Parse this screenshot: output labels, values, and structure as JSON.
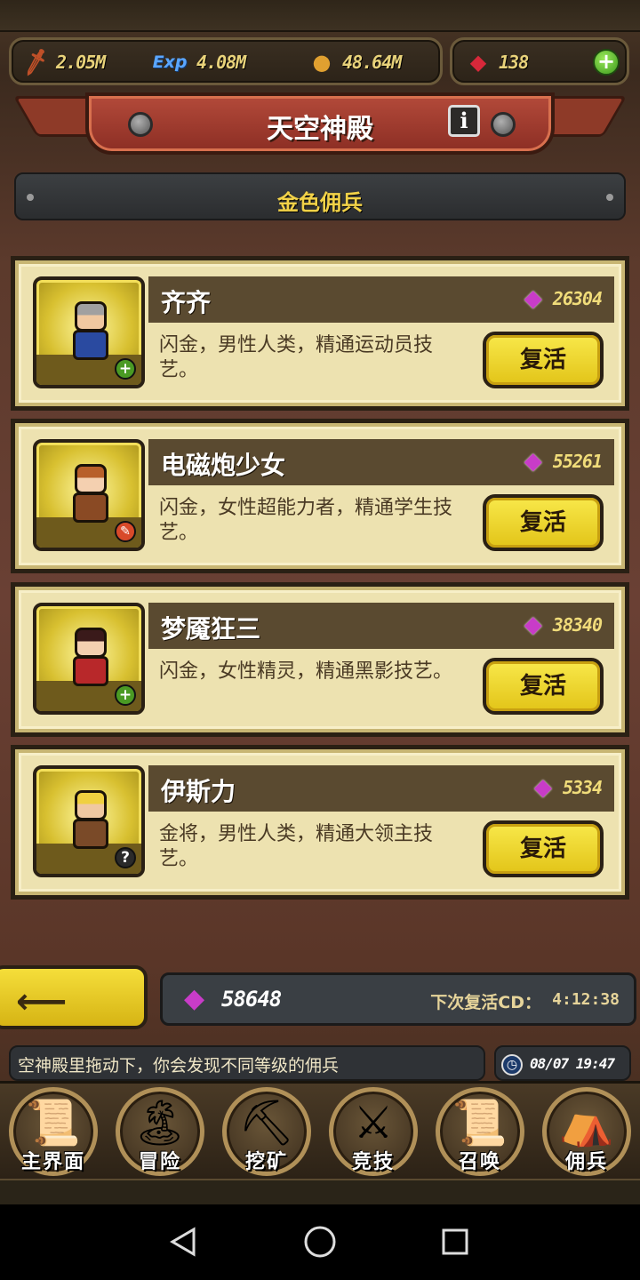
{
  "resources": {
    "attack": {
      "icon": "sword-icon",
      "value": "2.05M"
    },
    "exp": {
      "icon": "exp-icon",
      "label": "Exp",
      "value": "4.08M"
    },
    "gold": {
      "icon": "gold-coin-icon",
      "value": "48.64M"
    },
    "ruby": {
      "icon": "ruby-icon",
      "value": "138"
    }
  },
  "header": {
    "title": "天空神殿",
    "info_label": "i"
  },
  "category": {
    "label": "金色佣兵"
  },
  "heroes": [
    {
      "name": "齐齐",
      "cost": "26304",
      "desc": "闪金，男性人类，精通运动员技艺。",
      "button": "复活",
      "badge": "+",
      "palette": {
        "hair": "#a0a0a0",
        "body": "#2a4aa0",
        "skin": "#f0c8a0"
      }
    },
    {
      "name": "电磁炮少女",
      "cost": "55261",
      "desc": "闪金，女性超能力者，精通学生技艺。",
      "button": "复活",
      "badge": "✎",
      "palette": {
        "hair": "#b8602a",
        "body": "#8a4a24",
        "skin": "#f4d0b0"
      }
    },
    {
      "name": "梦魇狂三",
      "cost": "38340",
      "desc": "闪金，女性精灵，精通黑影技艺。",
      "button": "复活",
      "badge": "+",
      "palette": {
        "hair": "#3a1a1a",
        "body": "#b8282a",
        "skin": "#f4d0b0"
      }
    },
    {
      "name": "伊斯力",
      "cost": "5334",
      "desc": "金将，男性人类，精通大领主技艺。",
      "button": "复活",
      "badge": "?",
      "palette": {
        "hair": "#f0d040",
        "body": "#7a4a28",
        "skin": "#f0c8a0"
      }
    }
  ],
  "footer": {
    "back_label": "⟵",
    "gem_total": "58648",
    "cd_label": "下次复活CD：",
    "cd_value": "4:12:38",
    "ticker": "空神殿里拖动下，你会发现不同等级的佣兵",
    "datetime": "08/07 19:47"
  },
  "nav": [
    {
      "label": "主界面",
      "icon": "map-scroll-icon",
      "glyph": "📜"
    },
    {
      "label": "冒险",
      "icon": "island-icon",
      "glyph": "🏝"
    },
    {
      "label": "挖矿",
      "icon": "pickaxe-icon",
      "glyph": "⛏"
    },
    {
      "label": "竞技",
      "icon": "crossed-swords-icon",
      "glyph": "⚔"
    },
    {
      "label": "召唤",
      "icon": "summon-scroll-icon",
      "glyph": "📜"
    },
    {
      "label": "佣兵",
      "icon": "tent-icon",
      "glyph": "⛺"
    }
  ],
  "colors": {
    "gold_accent": "#f2d248",
    "button_yellow": "#f8e84a",
    "card_bg": "#ede2b0",
    "gem_purple": "#c83cc8"
  }
}
